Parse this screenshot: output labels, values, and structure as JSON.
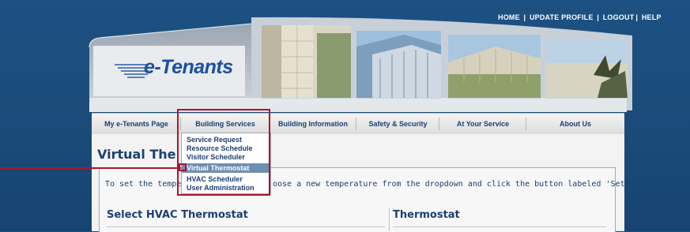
{
  "utility_nav": {
    "items": [
      "HOME",
      "UPDATE PROFILE",
      "LOGOUT",
      "HELP"
    ],
    "separator": "|"
  },
  "brand": {
    "logo_text": "e-Tenants",
    "brand_color": "#1b4fa1"
  },
  "main_nav": {
    "items": [
      {
        "label": "My e-Tenants Page"
      },
      {
        "label": "Building Services"
      },
      {
        "label": "Building Information"
      },
      {
        "label": "Safety & Security"
      },
      {
        "label": "At Your Service"
      },
      {
        "label": "About Us"
      }
    ]
  },
  "dropdown": {
    "items": [
      {
        "label": "Service Request"
      },
      {
        "label": "Resource Schedule"
      },
      {
        "label": "Visitor Scheduler"
      },
      {
        "label": "Virtual Thermostat"
      },
      {
        "label": "HVAC Scheduler"
      },
      {
        "label": "User Administration"
      }
    ],
    "active_index": 3,
    "highlight_color": "#b0142f"
  },
  "page": {
    "title": "Virtual The",
    "instructions_left": "To set the temper",
    "instructions_right": "oose a new temperature from the dropdown and click the button labeled 'Set'.",
    "section_select": "Select HVAC Thermostat",
    "section_thermostat": "Thermostat"
  },
  "colors": {
    "page_bg": "#1c4e7c",
    "nav_text": "#1c3f73",
    "accent_red": "#b0142f"
  }
}
